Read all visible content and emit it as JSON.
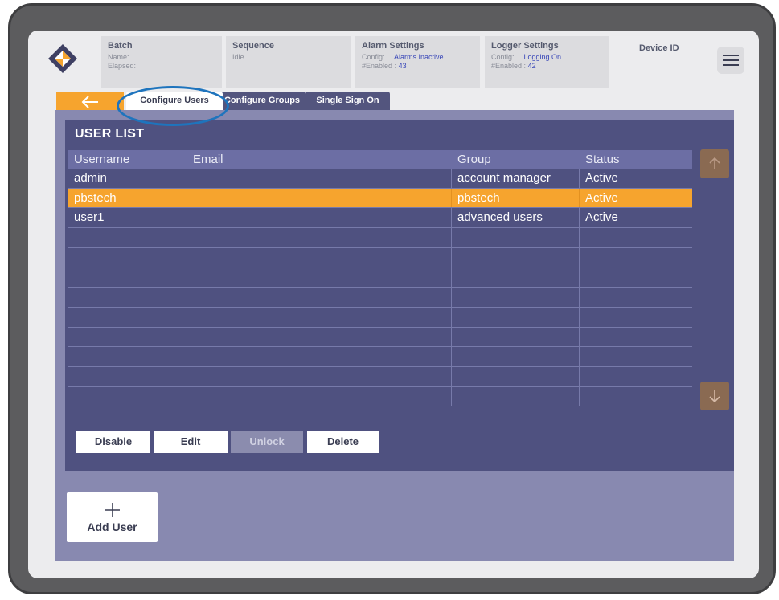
{
  "colors": {
    "accent": "#f6a42e",
    "panel": "#4f5180",
    "panel_outer": "#8889b0",
    "highlight": "#1e74bd"
  },
  "header": {
    "batch": {
      "title": "Batch",
      "name_label": "Name:",
      "elapsed_label": "Elapsed:"
    },
    "sequence": {
      "title": "Sequence",
      "state": "Idle"
    },
    "alarm": {
      "title": "Alarm Settings",
      "config_label": "Config:",
      "config_value": "Alarms Inactive",
      "enabled_label": "#Enabled :",
      "enabled_value": "43"
    },
    "logger": {
      "title": "Logger Settings",
      "config_label": "Config:",
      "config_value": "Logging On",
      "enabled_label": "#Enabled :",
      "enabled_value": "42"
    },
    "device_id_label": "Device ID",
    "menu_icon": "hamburger-menu-icon",
    "logo_icon": "diamond-logo-icon"
  },
  "tabs": {
    "back_icon": "arrow-left-icon",
    "items": [
      {
        "label": "Configure Users",
        "active": true
      },
      {
        "label": "Configure Groups",
        "active": false
      },
      {
        "label": "Single Sign On",
        "active": false
      }
    ]
  },
  "user_list": {
    "title": "USER LIST",
    "columns": [
      "Username",
      "Email",
      "Group",
      "Status"
    ],
    "rows": [
      {
        "username": "admin",
        "email": "",
        "group": "account manager",
        "status": "Active",
        "selected": false
      },
      {
        "username": "pbstech",
        "email": "",
        "group": "pbstech",
        "status": "Active",
        "selected": true
      },
      {
        "username": "user1",
        "email": "",
        "group": "advanced users",
        "status": "Active",
        "selected": false
      }
    ],
    "empty_row_count": 9,
    "scroll_up_icon": "arrow-up-icon",
    "scroll_down_icon": "arrow-down-icon"
  },
  "actions": {
    "disable": "Disable",
    "edit": "Edit",
    "unlock": "Unlock",
    "delete": "Delete"
  },
  "add_user": {
    "icon": "plus-icon",
    "label": "Add User"
  }
}
